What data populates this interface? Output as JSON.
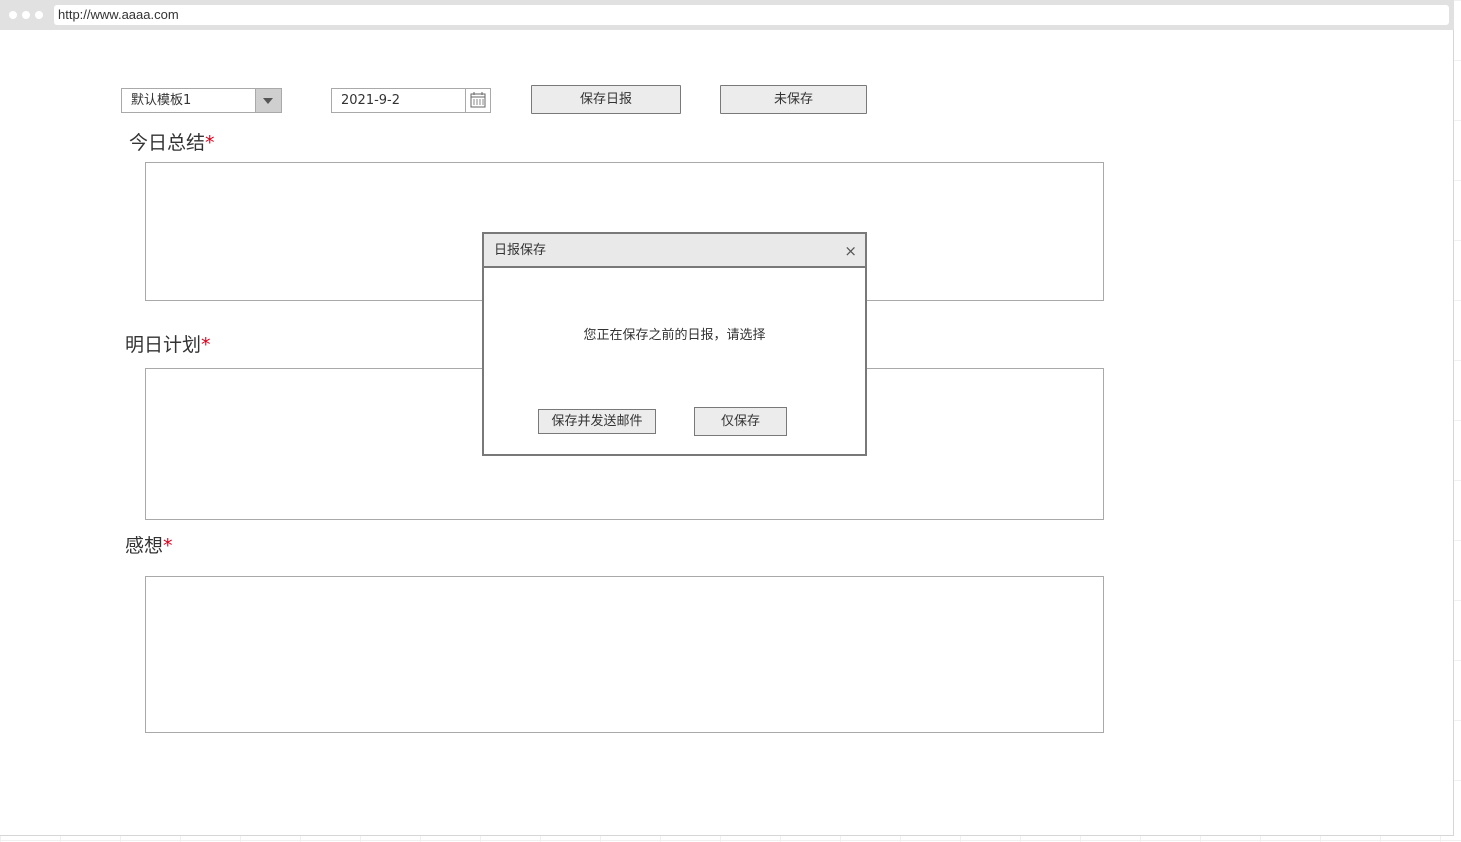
{
  "browser": {
    "url": "http://www.aaaa.com"
  },
  "toolbar": {
    "template_select": "默认模板1",
    "date_value": "2021-9-2",
    "save_report_label": "保存日报",
    "unsaved_label": "未保存"
  },
  "form": {
    "today_summary_label": "今日总结",
    "tomorrow_plan_label": "明日计划",
    "thoughts_label": "感想",
    "required_mark": "*"
  },
  "dialog": {
    "title": "日报保存",
    "close": "×",
    "message": "您正在保存之前的日报，请选择",
    "save_and_send_label": "保存并发送邮件",
    "save_only_label": "仅保存"
  },
  "icons": {
    "select_arrow": "chevron-down-icon",
    "date_picker": "calendar-icon",
    "dialog_close": "close-icon"
  }
}
